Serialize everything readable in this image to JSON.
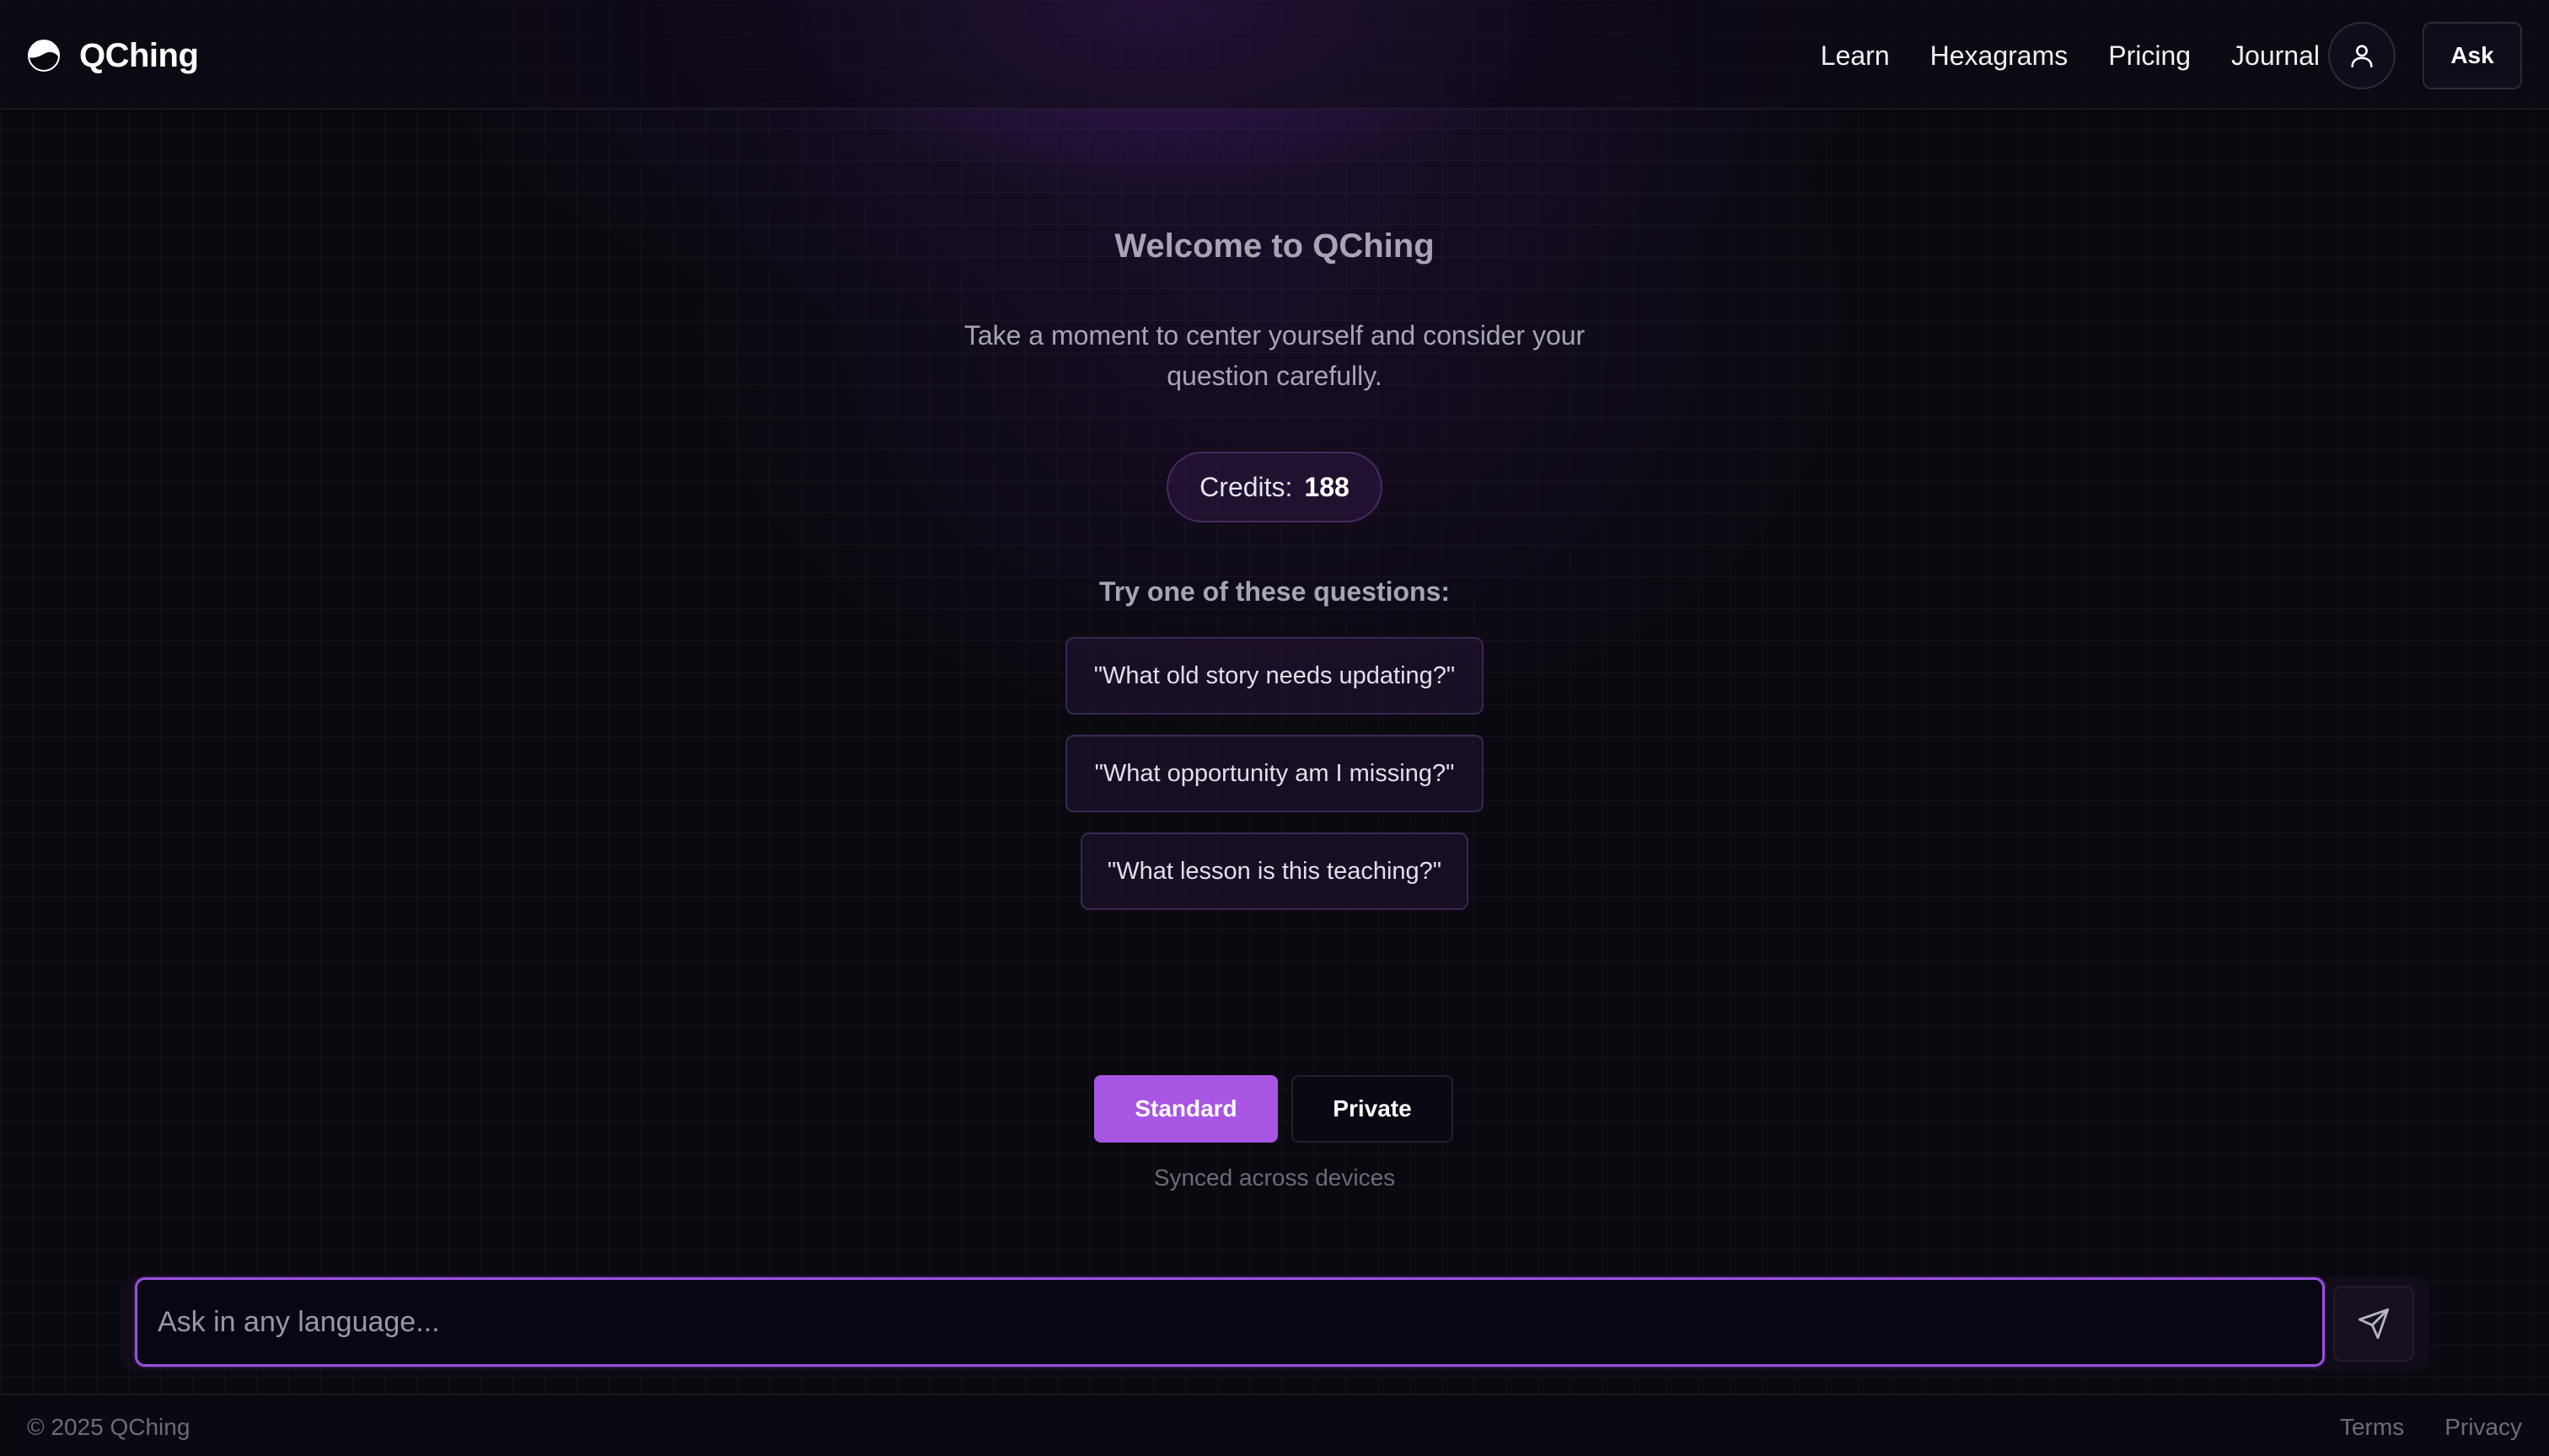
{
  "brand": {
    "name": "QChing",
    "logo_icon": "yin-yang-moon-icon"
  },
  "nav": {
    "links": [
      "Learn",
      "Hexagrams",
      "Pricing",
      "Journal"
    ],
    "user_icon": "user-icon",
    "ask_label": "Ask"
  },
  "main": {
    "title": "Welcome to QChing",
    "subtitle": "Take a moment to center yourself and consider your question carefully.",
    "credits_label": "Credits:",
    "credits_value": "188",
    "suggestions_heading": "Try one of these questions:",
    "suggestions": [
      "\"What old story needs updating?\"",
      "\"What opportunity am I missing?\"",
      "\"What lesson is this teaching?\""
    ]
  },
  "mode": {
    "options": [
      "Standard",
      "Private"
    ],
    "selected": "Standard",
    "note": "Synced across devices"
  },
  "input": {
    "placeholder": "Ask in any language...",
    "value": "",
    "send_icon": "send-icon"
  },
  "footer": {
    "copyright": "© 2025 QChing",
    "links": [
      "Terms",
      "Privacy"
    ]
  },
  "colors": {
    "accent": "#a855e3",
    "input_border": "#9b4fe0",
    "background": "#0b0910"
  }
}
